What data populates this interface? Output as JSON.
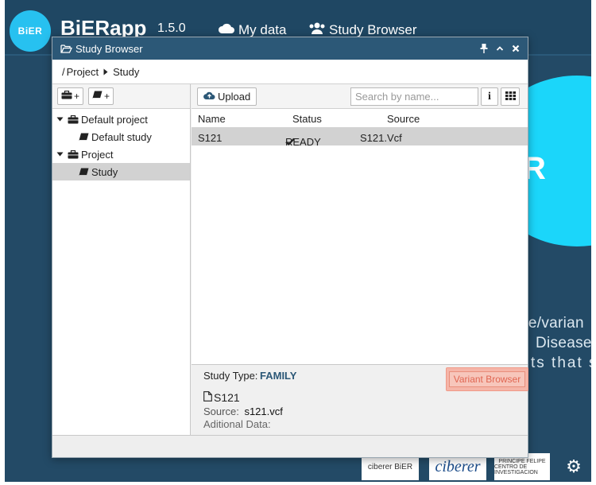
{
  "app": {
    "logo_text": "BiER",
    "title": "BiERapp",
    "version": "1.5.0",
    "nav": {
      "my_data": "My data",
      "study_browser": "Study Browser"
    },
    "background_letter": "R",
    "background_lines": [
      "ne/varian",
      "Disease",
      "ts  that  s"
    ],
    "sponsors": {
      "s1": "ciberer BiER",
      "s2": "ciberer",
      "s3_line1": "PRINCIPE FELIPE",
      "s3_line2": "CENTRO DE INVESTIGACION",
      "s4": "⚙"
    }
  },
  "window": {
    "title": "Study Browser",
    "breadcrumb": {
      "root": "/",
      "project": "Project",
      "study": "Study"
    },
    "sidebar": {
      "add_project_label": "+",
      "add_study_label": "+",
      "tree": [
        {
          "label": "Default project",
          "type": "project"
        },
        {
          "label": "Default study",
          "type": "study"
        },
        {
          "label": "Project",
          "type": "project"
        },
        {
          "label": "Study",
          "type": "study",
          "selected": true
        }
      ]
    },
    "main": {
      "upload_label": "Upload",
      "search_placeholder": "Search by name...",
      "info_label": "i",
      "columns": {
        "name": "Name",
        "status": "Status",
        "source": "Source"
      },
      "rows": [
        {
          "name": "S121",
          "status": "READY",
          "source": "S121.Vcf"
        }
      ]
    },
    "detail": {
      "study_type_label": "Study Type:",
      "study_type_value": "FAMILY",
      "variant_browser_label": "Variant Browser",
      "file_name": "S121",
      "source_label": "Source:",
      "source_value": "s121.vcf",
      "additional_label": "Aditional Data:"
    }
  },
  "colors": {
    "titlebar": "#2c5877",
    "app_background": "#234a66",
    "accent_cyan": "#1bd6fa",
    "variant_button": "#f5b5a8",
    "selected_row": "#d2d2d2"
  }
}
